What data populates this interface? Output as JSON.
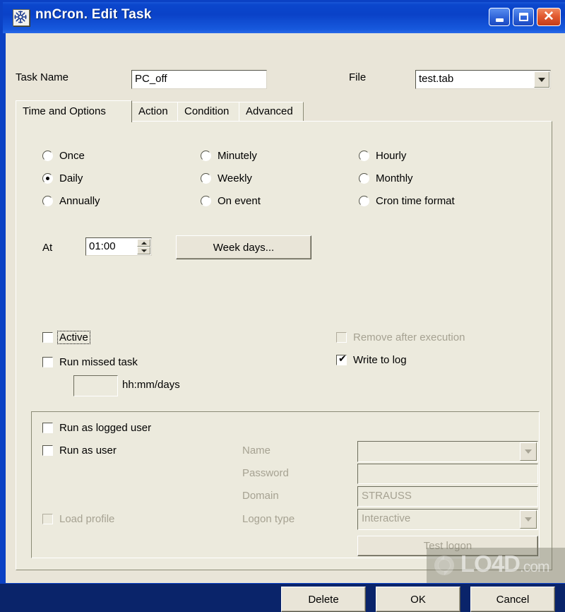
{
  "window": {
    "title": "nnCron. Edit Task",
    "icon": "snowflake-icon",
    "controls": {
      "minimize": "Minimize",
      "maximize": "Maximize",
      "close": "Close"
    },
    "colors": {
      "titlebar": "#0b41c4",
      "client": "#e9e5d8",
      "panel": "#eceadd",
      "close_button": "#e25b32",
      "disabled_text": "#a6a292"
    }
  },
  "header": {
    "task_name_label": "Task Name",
    "task_name_value": "PC_off",
    "file_label": "File",
    "file_value": "test.tab"
  },
  "tabs": [
    {
      "label": "Time and Options",
      "active": true
    },
    {
      "label": "Action",
      "active": false
    },
    {
      "label": "Condition",
      "active": false
    },
    {
      "label": "Advanced",
      "active": false
    }
  ],
  "schedule": {
    "radios": [
      {
        "label": "Once",
        "checked": false,
        "col": 0,
        "row": 0
      },
      {
        "label": "Daily",
        "checked": true,
        "col": 0,
        "row": 1
      },
      {
        "label": "Annually",
        "checked": false,
        "col": 0,
        "row": 2
      },
      {
        "label": "Minutely",
        "checked": false,
        "col": 1,
        "row": 0
      },
      {
        "label": "Weekly",
        "checked": false,
        "col": 1,
        "row": 1
      },
      {
        "label": "On event",
        "checked": false,
        "col": 1,
        "row": 2
      },
      {
        "label": "Hourly",
        "checked": false,
        "col": 2,
        "row": 0
      },
      {
        "label": "Monthly",
        "checked": false,
        "col": 2,
        "row": 1
      },
      {
        "label": "Cron time format",
        "checked": false,
        "col": 2,
        "row": 2
      }
    ],
    "at_label": "At",
    "at_value": "01:00",
    "week_days_button": "Week days..."
  },
  "options": {
    "active_label": "Active",
    "active_checked": false,
    "active_focused": true,
    "run_missed_label": "Run missed task",
    "run_missed_checked": false,
    "run_missed_value": "",
    "hhmm_hint": "hh:mm/days",
    "remove_after_label": "Remove after execution",
    "remove_after_checked": false,
    "remove_after_disabled": true,
    "write_log_label": "Write to log",
    "write_log_checked": true,
    "checkmark": "✔"
  },
  "run_as": {
    "run_as_logged_label": "Run as logged user",
    "run_as_logged_checked": false,
    "run_as_user_label": "Run as user",
    "run_as_user_checked": false,
    "load_profile_label": "Load profile",
    "load_profile_checked": false,
    "load_profile_disabled": true,
    "name_label": "Name",
    "name_value": "",
    "password_label": "Password",
    "password_value": "",
    "domain_label": "Domain",
    "domain_value": "STRAUSS",
    "logon_type_label": "Logon type",
    "logon_type_value": "Interactive",
    "test_logon_button": "Test logon"
  },
  "footer": {
    "delete_label": "Delete",
    "ok_label": "OK",
    "cancel_label": "Cancel"
  },
  "watermark": {
    "text_main": "LO4D",
    "text_suffix": ".com",
    "icon": "refresh-circle-icon"
  }
}
